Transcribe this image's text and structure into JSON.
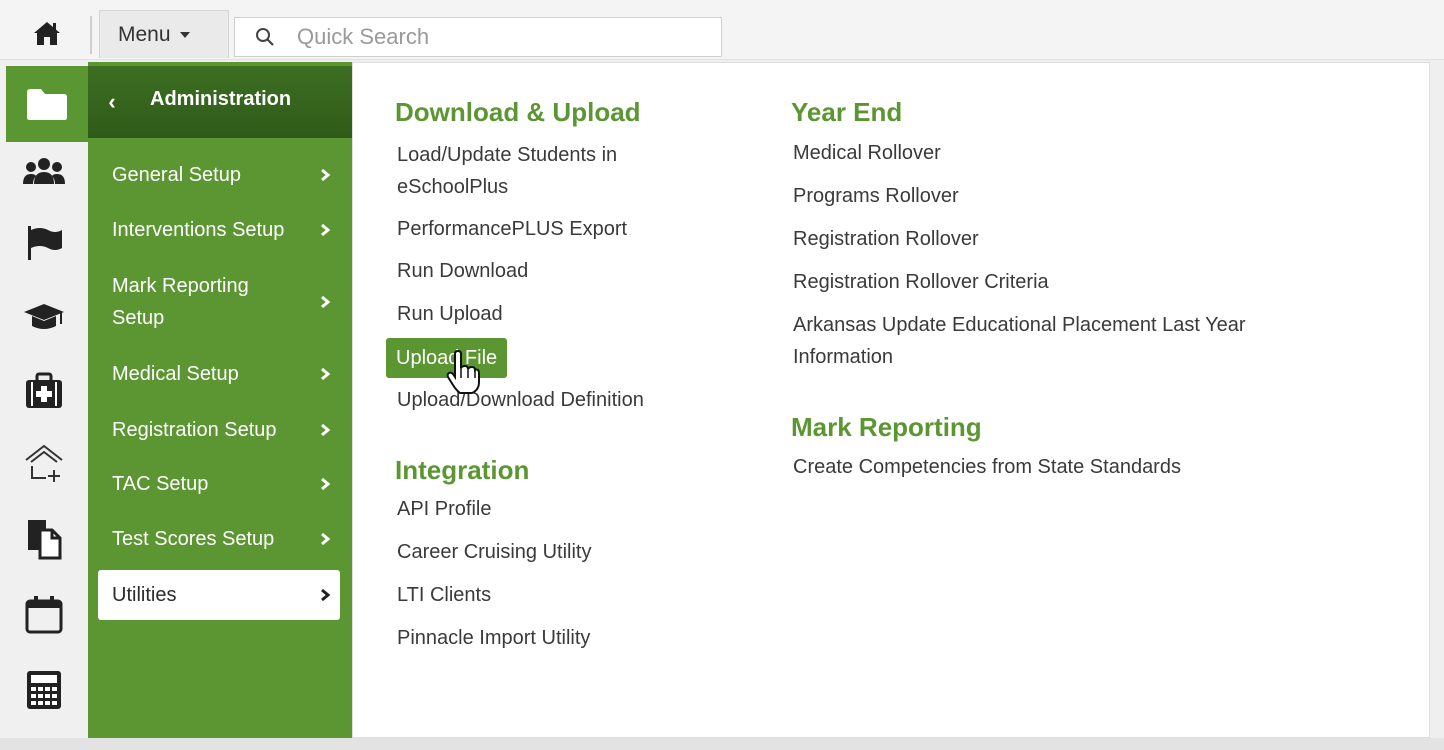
{
  "topbar": {
    "menu_label": "Menu",
    "search_placeholder": "Quick Search"
  },
  "nav": {
    "title": "Administration",
    "items": [
      {
        "label": "General Setup"
      },
      {
        "label": "Interventions Setup"
      },
      {
        "label": "Mark Reporting Setup"
      },
      {
        "label": "Medical Setup"
      },
      {
        "label": "Registration Setup"
      },
      {
        "label": "TAC Setup"
      },
      {
        "label": "Test Scores Setup"
      },
      {
        "label": "Utilities",
        "selected": true
      }
    ]
  },
  "rail_icons": [
    "folder-icon",
    "users-icon",
    "flag-icon",
    "graduation-cap-icon",
    "medical-kit-icon",
    "home-plus-icon",
    "documents-icon",
    "calendar-icon",
    "calculator-icon"
  ],
  "content": {
    "download_upload": {
      "title": "Download & Upload",
      "links": [
        "Load/Update Students in eSchoolPlus",
        "PerformancePLUS Export",
        "Run Download",
        "Run Upload",
        "Upload File",
        "Upload/Download Definition"
      ],
      "highlighted": "Upload File"
    },
    "integration": {
      "title": "Integration",
      "links": [
        "API Profile",
        "Career Cruising Utility",
        "LTI Clients",
        "Pinnacle Import Utility"
      ]
    },
    "year_end": {
      "title": "Year End",
      "links": [
        "Medical Rollover",
        "Programs Rollover",
        "Registration Rollover",
        "Registration Rollover Criteria",
        "Arkansas Update Educational Placement Last Year Information"
      ]
    },
    "mark_reporting": {
      "title": "Mark Reporting",
      "links": [
        "Create Competencies from State Standards"
      ]
    }
  },
  "colors": {
    "accent": "#5b9632",
    "nav_header": "#2f5b19"
  }
}
